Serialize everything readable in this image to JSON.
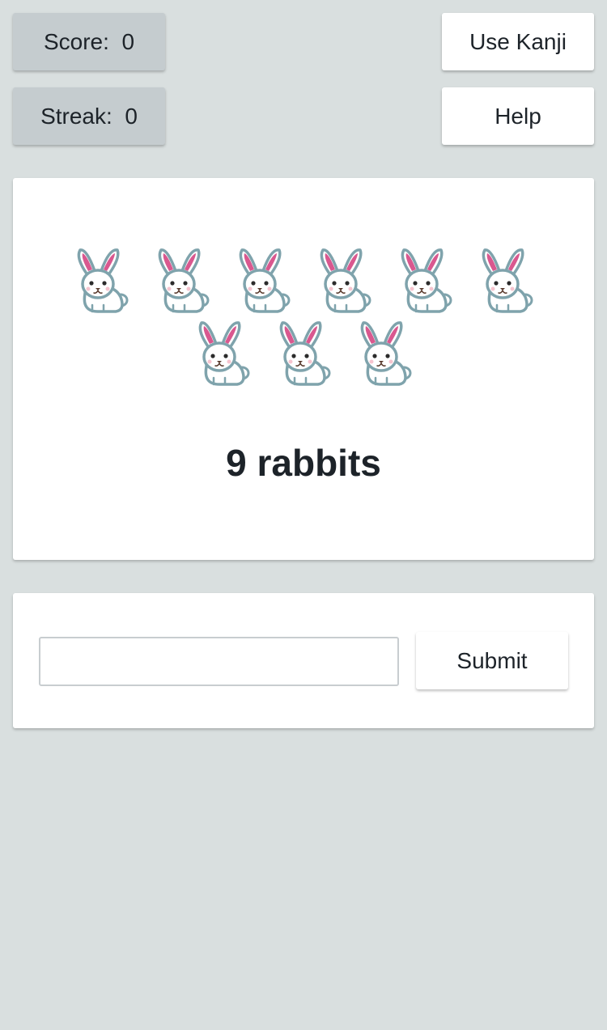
{
  "score": {
    "label": "Score:",
    "value": "0"
  },
  "streak": {
    "label": "Streak:",
    "value": "0"
  },
  "buttons": {
    "use_kanji": "Use Kanji",
    "help": "Help",
    "submit": "Submit"
  },
  "question": {
    "rabbit_count": 9,
    "icon": "rabbit-emoji",
    "text": "9 rabbits"
  },
  "answer": {
    "value": "",
    "placeholder": ""
  },
  "colors": {
    "background": "#d9dfdf",
    "stat_box": "#c5cccf",
    "card": "#ffffff",
    "text": "#1d2329",
    "rabbit_outline": "#7fa3ac",
    "rabbit_ear": "#d9588f"
  }
}
